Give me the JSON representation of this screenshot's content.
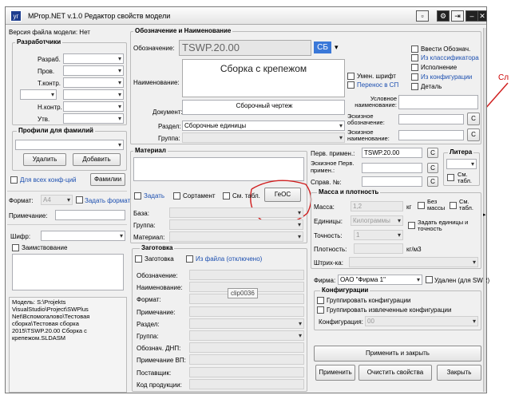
{
  "title": "MProp.NET v.1.0  Редактор свойств модели",
  "red_hint": "Сл",
  "version_label": "Версия файла модели:  Нет",
  "developers": {
    "title": "Разработчики",
    "rows": [
      "Разраб.",
      "Пров.",
      "Т.контр.",
      "",
      "Н.контр.",
      "Утв."
    ]
  },
  "profiles": {
    "title": "Профили для фамилий",
    "delete": "Удалить",
    "add": "Добавить",
    "all_conf": "Для всех конф-ций",
    "surnames": "Фамилии"
  },
  "format": {
    "label": "Формат:",
    "value": "A4",
    "set": "Задать формат"
  },
  "note_label": "Примечание:",
  "cipher_label": "Шифр:",
  "borrowed": "Заимствование",
  "model_path": "Модель: S:\\Projekts VisualStudio\\Project\\SWPlus Net\\Вспомогалово\\Тестовая сборка\\Тестовая сборка 2015\\TSWP.20.00 Сборка с крепежом.SLDASM",
  "desig": {
    "title": "Обозначение и Наименование",
    "des_label": "Обозначение:",
    "des_value": "TSWP.20.00",
    "sb": "СБ",
    "name_label": "Наименование:",
    "name_value": "Сборка с крепежом",
    "doc_label": "Документ:",
    "doc_value": "Сборочный чертеж",
    "section_label": "Раздел:",
    "section_value": "Сборочные единицы",
    "group_label": "Группа:",
    "small_font": "Умен. шрифт",
    "transfer": "Перенос в СП",
    "enter_des": "Ввести Обознач.",
    "from_class": "Из классификатора",
    "exec": "Исполнение",
    "from_conf": "Из конфигурации",
    "part": "Деталь",
    "cond_name": "Условное наименование:",
    "sketch_des": "Эскизное обозначение:",
    "sketch_name": "Эскизное наименование:",
    "c": "С"
  },
  "material": {
    "title": "Материал",
    "geos": "ГеОС",
    "set": "Задать",
    "sortament": "Сортамент",
    "sm_tabl": "См. табл.",
    "base": "База:",
    "group": "Группа:",
    "material": "Материал:"
  },
  "blank": {
    "title": "Заготовка",
    "blank_cb": "Заготовка",
    "from_file": "Из файла (отключено)",
    "rows": [
      "Обозначение:",
      "Наименование:",
      "Формат:",
      "Примечание:",
      "Раздел:",
      "Группа:",
      "Обознач. ДНП:",
      "Примечание ВП:",
      "Поставщик:",
      "Код продукции:"
    ],
    "tooltip": "clip0036"
  },
  "primary": {
    "first_use": "Перв. примен.:",
    "first_use_val": "TSWP.20.00",
    "sketch_first": "Эскизное Перв. примен.:",
    "ref": "Справ. №:",
    "c": "С"
  },
  "litera": {
    "title": "Литера",
    "sm": "См. табл."
  },
  "mass": {
    "title": "Масса и плотность",
    "mass_label": "Масса:",
    "mass_val": "1,2",
    "kg": "кг",
    "no_mass": "Без массы",
    "sm_tabl": "См. табл.",
    "units_label": "Единицы:",
    "units_val": "Килограммы",
    "set_units": "Задать единицы и точность",
    "acc_label": "Точность:",
    "acc_val": "1",
    "density_label": "Плотность:",
    "density_unit": "кг/м3",
    "barcode": "Штрих-ка:"
  },
  "firm": {
    "label": "Фирма:",
    "value": "ОАО \"Фирма 1\"",
    "removed": "Удален (для SWR)"
  },
  "configs": {
    "title": "Конфигурации",
    "group_conf": "Группировать конфигурации",
    "group_ext": "Группировать извлеченные конфигурации",
    "conf_label": "Конфигурация:",
    "conf_val": "00"
  },
  "buttons": {
    "apply_close": "Применить и закрыть",
    "apply": "Применить",
    "clear": "Очистить свойства",
    "close": "Закрыть"
  }
}
